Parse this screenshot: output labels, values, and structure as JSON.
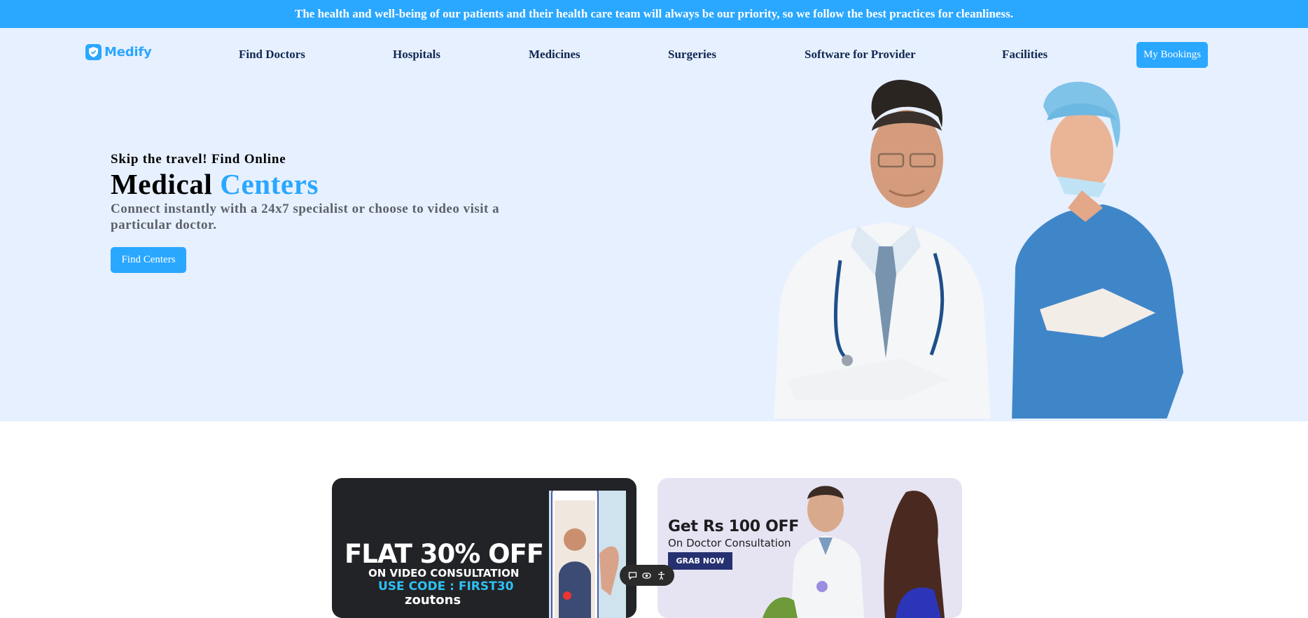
{
  "announcement": "The health and well-being of our patients and their health care team will always be our priority, so we follow the best practices for cleanliness.",
  "brand": {
    "name": "Medify",
    "icon": "shield-check-icon",
    "color": "#2aa7ff"
  },
  "nav": {
    "items": [
      {
        "label": "Find Doctors"
      },
      {
        "label": "Hospitals"
      },
      {
        "label": "Medicines"
      },
      {
        "label": "Surgeries"
      },
      {
        "label": "Software for Provider"
      },
      {
        "label": "Facilities"
      }
    ],
    "cta_label": "My Bookings"
  },
  "hero": {
    "subtitle": "Skip the travel! Find Online",
    "title_main": "Medical",
    "title_accent": "Centers",
    "description": "Connect instantly with a 24x7 specialist or choose to video visit a particular doctor.",
    "button_label": "Find Centers"
  },
  "offers": [
    {
      "headline": "FLAT 30% OFF",
      "subline": "ON VIDEO CONSULTATION",
      "code": "USE CODE : FIRST30",
      "brand": "zoutons"
    },
    {
      "headline": "Get Rs 100 OFF",
      "subline": "On Doctor Consultation",
      "button_label": "GRAB NOW"
    }
  ],
  "floating_toolbar": {
    "icons": [
      "chat-icon",
      "eye-icon",
      "accessibility-icon"
    ]
  },
  "colors": {
    "accent": "#2aa7ff",
    "hero_bg": "#e7f0ff",
    "nav_text": "#102851"
  }
}
